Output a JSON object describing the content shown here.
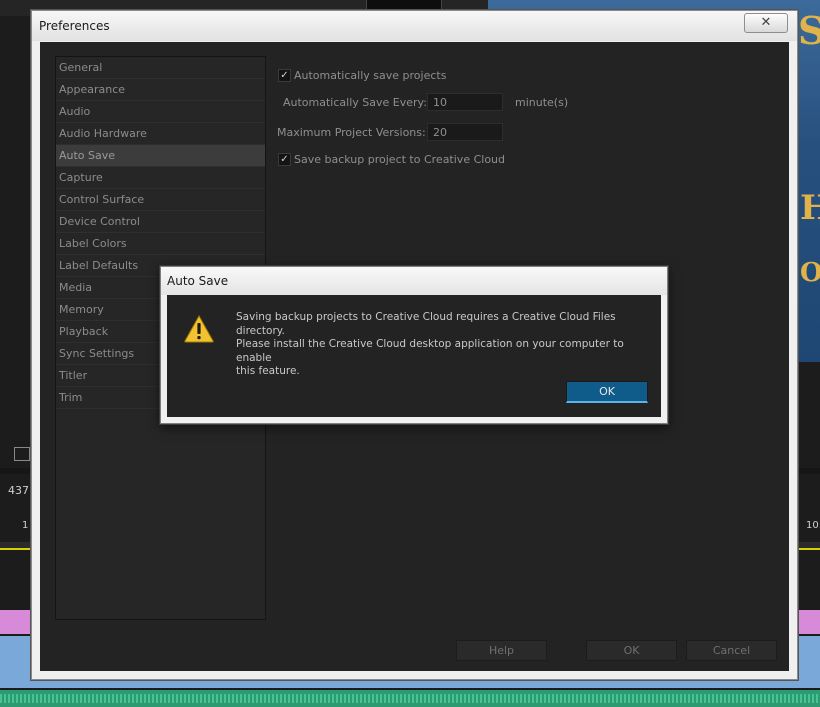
{
  "background": {
    "timecode": "437",
    "left_tick": "1",
    "right_time": "10:"
  },
  "preferences": {
    "title": "Preferences",
    "close_glyph": "✕",
    "sidebar": {
      "items": [
        {
          "label": "General"
        },
        {
          "label": "Appearance"
        },
        {
          "label": "Audio"
        },
        {
          "label": "Audio Hardware"
        },
        {
          "label": "Auto Save"
        },
        {
          "label": "Capture"
        },
        {
          "label": "Control Surface"
        },
        {
          "label": "Device Control"
        },
        {
          "label": "Label Colors"
        },
        {
          "label": "Label Defaults"
        },
        {
          "label": "Media"
        },
        {
          "label": "Memory"
        },
        {
          "label": "Playback"
        },
        {
          "label": "Sync Settings"
        },
        {
          "label": "Titler"
        },
        {
          "label": "Trim"
        }
      ],
      "selected": "Auto Save"
    },
    "auto_save": {
      "auto_save_checkbox_label": "Automatically save projects",
      "auto_save_checked": true,
      "save_every_label": "Automatically Save Every:",
      "save_every_value": "10",
      "save_every_unit": "minute(s)",
      "max_versions_label": "Maximum Project Versions:",
      "max_versions_value": "20",
      "cloud_backup_label": "Save backup project to Creative Cloud",
      "cloud_backup_checked": true
    },
    "buttons": {
      "help": "Help",
      "ok": "OK",
      "cancel": "Cancel"
    }
  },
  "alert": {
    "title": "Auto Save",
    "icon": "warning-icon",
    "message_line1": "Saving backup projects to Creative Cloud requires a Creative Cloud Files\ndirectory.",
    "message_line2": "Please install the Creative Cloud desktop application on your computer to enable\nthis feature.",
    "ok_label": "OK",
    "ok_color": "#0f5b8a"
  }
}
